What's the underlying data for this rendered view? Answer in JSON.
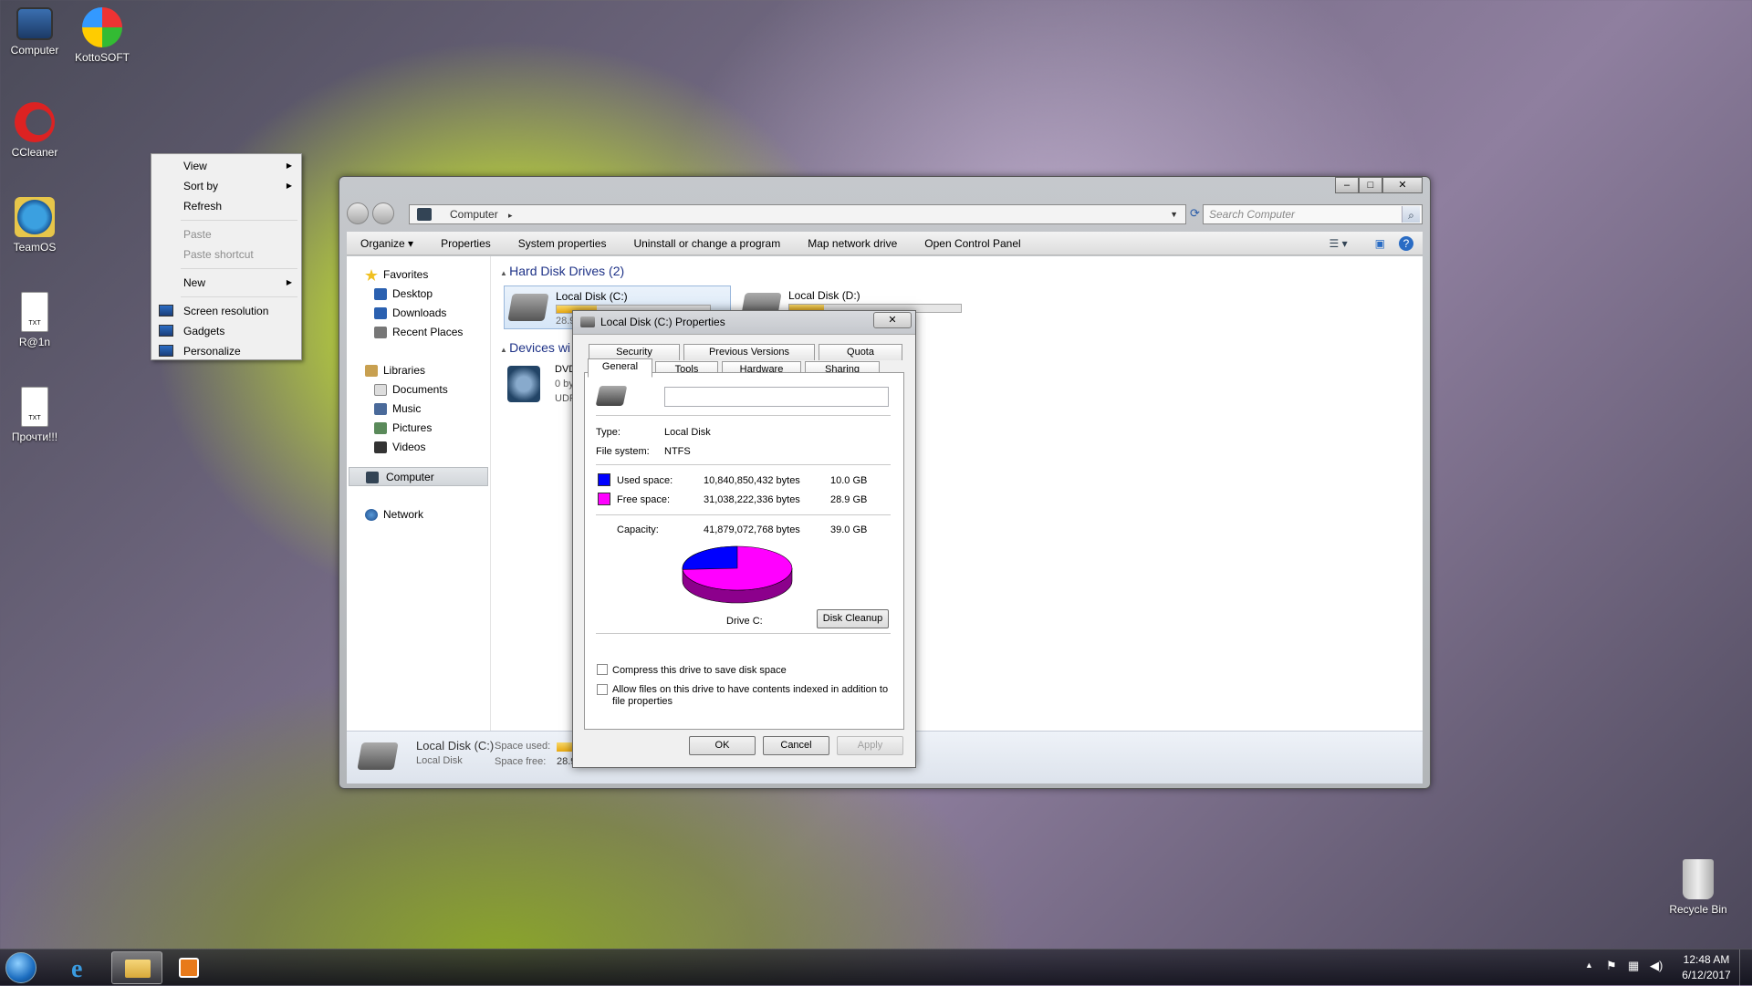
{
  "desktop": {
    "icons": [
      {
        "label": "Computer",
        "icon": "computer-icon"
      },
      {
        "label": "KottoSOFT",
        "icon": "kottosoft-icon"
      },
      {
        "label": "CCleaner",
        "icon": "ccleaner-icon"
      },
      {
        "label": "TeamOS",
        "icon": "teamos-icon"
      },
      {
        "label": "R@1n",
        "icon": "txt-file-icon"
      },
      {
        "label": "Прочти!!!",
        "icon": "txt-file-icon"
      },
      {
        "label": "Recycle Bin",
        "icon": "recycle-bin-icon"
      }
    ],
    "txt_badge": "TXT"
  },
  "context_menu": {
    "view": "View",
    "sort_by": "Sort by",
    "refresh": "Refresh",
    "paste": "Paste",
    "paste_shortcut": "Paste shortcut",
    "new": "New",
    "screen_resolution": "Screen resolution",
    "gadgets": "Gadgets",
    "personalize": "Personalize"
  },
  "explorer": {
    "address": "Computer",
    "search_placeholder": "Search Computer",
    "toolbar": [
      "Organize ▾",
      "Properties",
      "System properties",
      "Uninstall or change a program",
      "Map network drive",
      "Open Control Panel"
    ],
    "nav": {
      "favorites": "Favorites",
      "desktop": "Desktop",
      "downloads": "Downloads",
      "recent_places": "Recent Places",
      "libraries": "Libraries",
      "documents": "Documents",
      "music": "Music",
      "pictures": "Pictures",
      "videos": "Videos",
      "computer": "Computer",
      "network": "Network"
    },
    "hard_disk_header": "Hard Disk Drives (2)",
    "devices_header": "Devices wi",
    "drive_c": {
      "name": "Local Disk (C:)",
      "free_text": "28.9",
      "used_fraction": 0.26
    },
    "drive_d": {
      "name": "Local Disk (D:)",
      "used_fraction": 0.2
    },
    "dvd": {
      "line1": "DVD",
      "line2": "0 by",
      "line3": "UDF"
    },
    "status": {
      "name": "Local Disk (C:)",
      "type": "Local Disk",
      "space_used_label": "Space used:",
      "space_free_label": "Space free:",
      "space_free_value": "28.9"
    }
  },
  "dialog": {
    "title": "Local Disk (C:) Properties",
    "tabs_row1": [
      "Security",
      "Previous Versions",
      "Quota"
    ],
    "tabs_row2": [
      "General",
      "Tools",
      "Hardware",
      "Sharing"
    ],
    "name_value": "",
    "type_label": "Type:",
    "type_value": "Local Disk",
    "fs_label": "File system:",
    "fs_value": "NTFS",
    "used_label": "Used space:",
    "used_bytes": "10,840,850,432 bytes",
    "used_gb": "10.0 GB",
    "free_label": "Free space:",
    "free_bytes": "31,038,222,336 bytes",
    "free_gb": "28.9 GB",
    "capacity_label": "Capacity:",
    "capacity_bytes": "41,879,072,768 bytes",
    "capacity_gb": "39.0 GB",
    "drive_label": "Drive C:",
    "disk_cleanup": "Disk Cleanup",
    "compress": "Compress this drive to save disk space",
    "index_line1": "Allow files on this drive to have contents indexed in addition to",
    "index_line2": "file properties",
    "ok": "OK",
    "cancel": "Cancel",
    "apply": "Apply",
    "used_color": "#0000ff",
    "free_color": "#ff00ff",
    "used_fraction": 0.259
  },
  "taskbar": {
    "time": "12:48 AM",
    "date": "6/12/2017"
  }
}
